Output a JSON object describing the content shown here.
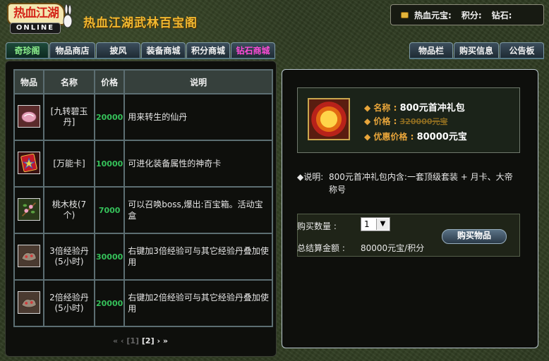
{
  "header": {
    "logo_top": "热血江湖",
    "logo_bottom": "ONLINE",
    "title": "热血江湖武林百宝阁",
    "balance": {
      "yuanbao_label": "热血元宝:",
      "points_label": "积分:",
      "diamond_label": "钻石:"
    }
  },
  "tabs_left": [
    {
      "label": "奇珍阁",
      "active": true
    },
    {
      "label": "物品商店"
    },
    {
      "label": "披风"
    },
    {
      "label": "装备商城"
    },
    {
      "label": "积分商城"
    },
    {
      "label": "钻石商城"
    }
  ],
  "tabs_right": [
    {
      "label": "物品栏"
    },
    {
      "label": "购买信息"
    },
    {
      "label": "公告板"
    }
  ],
  "table": {
    "headers": [
      "物品",
      "名称",
      "价格",
      "说明"
    ],
    "rows": [
      {
        "icon": "pink-pill-icon",
        "name": "[九转碧玉丹]",
        "price": "20000",
        "desc": "用来转生的仙丹"
      },
      {
        "icon": "star-card-icon",
        "name": "[万能卡]",
        "price": "10000",
        "desc": "可进化装备属性的神奇卡"
      },
      {
        "icon": "peach-branch-icon",
        "name": "桃木枝(7个)",
        "price": "7000",
        "desc": "可以召唤boss,爆出:百宝箱。活动宝盒"
      },
      {
        "icon": "exp-pill-icon",
        "name": "3倍经验丹(5小时)",
        "price": "30000",
        "desc": "右键加3倍经验可与其它经验丹叠加使用"
      },
      {
        "icon": "exp-pill-icon",
        "name": "2倍经验丹(5小时)",
        "price": "20000",
        "desc": "右键加2倍经验可与其它经验丹叠加使用"
      }
    ]
  },
  "pager": {
    "first": "«",
    "prev": "‹",
    "page1": "[1]",
    "page2": "[2]",
    "next": "›",
    "last": "»"
  },
  "product": {
    "name_label": "名称",
    "name": "800元首冲礼包",
    "price_label": "价格",
    "price": "320000元宝",
    "sale_label": "优惠价格",
    "sale_price": "80000元宝",
    "desc_label": "说明:",
    "desc": "800元首冲礼包内含:一套顶级套装 + 月卡、大帝称号"
  },
  "purchase": {
    "qty_label": "购买数量 :",
    "qty_value": "1",
    "total_label": "总结算金额 :",
    "total_value": "80000元宝/积分",
    "buy_label": "购买物品"
  }
}
